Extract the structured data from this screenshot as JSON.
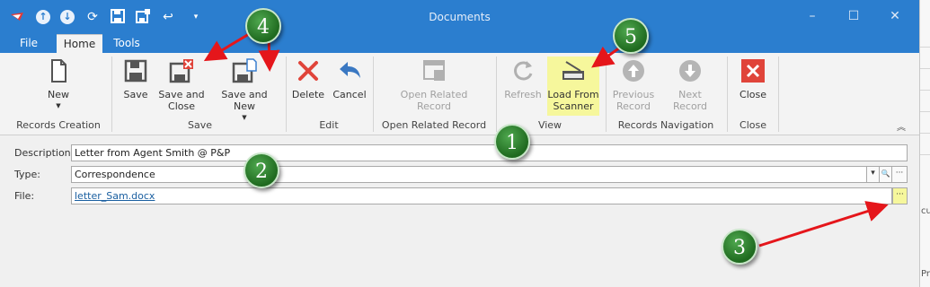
{
  "window": {
    "title": "Documents",
    "controls": {
      "minimize": "–",
      "maximize": "☐",
      "close": "✕"
    }
  },
  "qat": {
    "icons": [
      "app-logo-icon",
      "upload-icon",
      "download-icon",
      "refresh-icon",
      "save-icon",
      "save-new-icon",
      "undo-icon",
      "customize-dropdown-icon"
    ]
  },
  "tabs": [
    {
      "label": "File"
    },
    {
      "label": "Home",
      "active": true
    },
    {
      "label": "Tools"
    }
  ],
  "ribbon": {
    "buttons": {
      "new": "New",
      "save": "Save",
      "save_close": "Save and\nClose",
      "save_new": "Save and New",
      "delete": "Delete",
      "cancel": "Cancel",
      "open_related": "Open Related\nRecord",
      "refresh": "Refresh",
      "load_scanner": "Load From\nScanner",
      "previous": "Previous\nRecord",
      "next": "Next Record",
      "close": "Close"
    },
    "groups": {
      "records_creation": "Records Creation",
      "save": "Save",
      "edit": "Edit",
      "open_related": "Open Related Record",
      "view": "View",
      "navigation": "Records Navigation",
      "close": "Close"
    },
    "collapse_glyph": "︽"
  },
  "form": {
    "description": {
      "label": "Description:",
      "value": "Letter from Agent Smith @ P&P"
    },
    "type": {
      "label": "Type:",
      "value": "Correspondence"
    },
    "file": {
      "label": "File:",
      "value": "letter_Sam.docx"
    },
    "ellipsis": "···",
    "dropdown_glyph": "▾",
    "search_glyph": "🔍"
  },
  "annotations": [
    "1",
    "2",
    "3",
    "4",
    "5"
  ],
  "background_fragments": [
    "cu",
    "Pr"
  ],
  "colors": {
    "titlebar": "#2b7ecf",
    "ribbon_bg": "#f3f3f3",
    "highlight": "#f6f79c",
    "marker_green": "#2e7d2e",
    "arrow_red": "#e5161b",
    "delete_red": "#e0443a",
    "link_blue": "#1a5fa0"
  }
}
